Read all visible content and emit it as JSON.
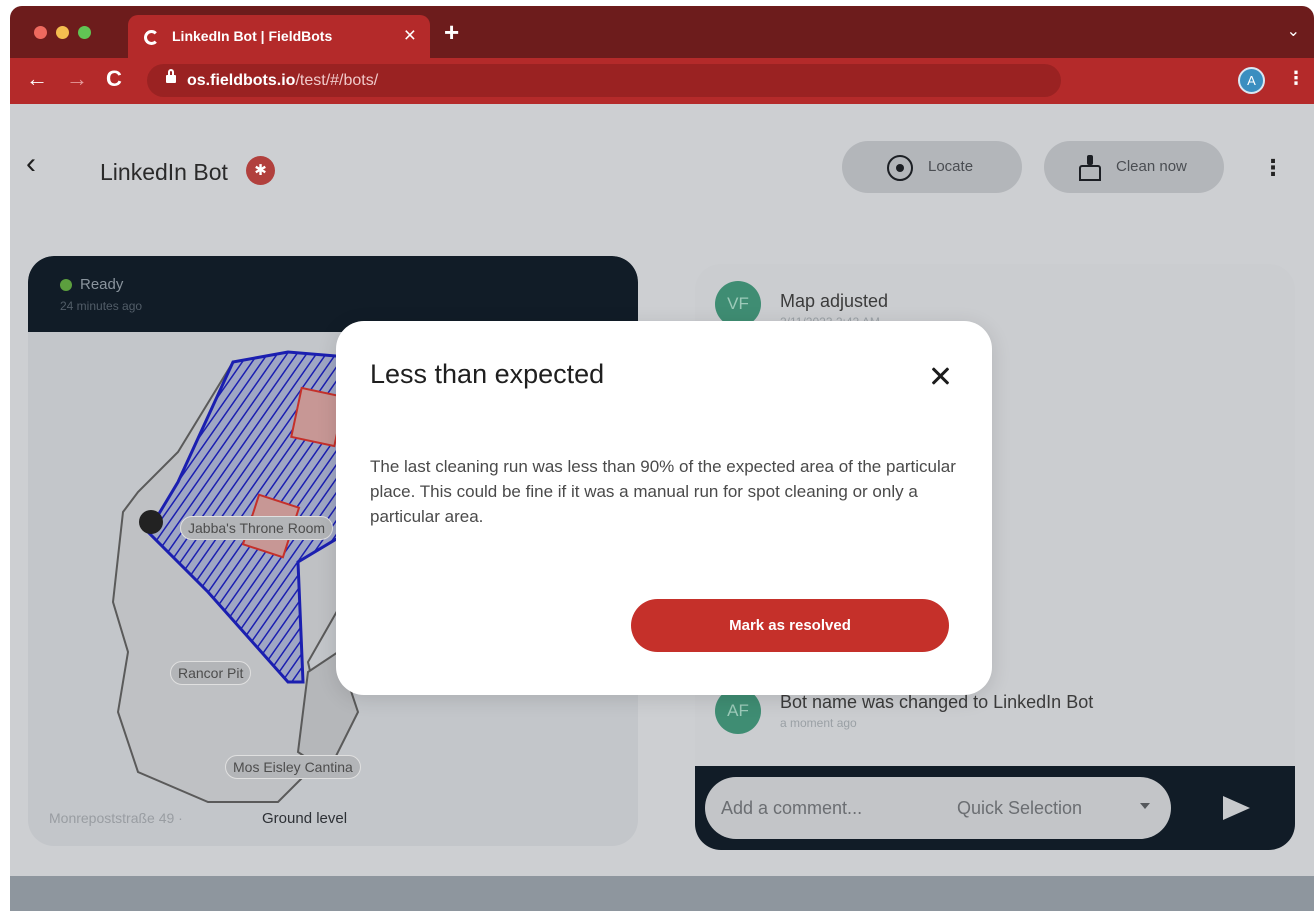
{
  "browser": {
    "tab_title": "LinkedIn Bot | FieldBots",
    "tab_close": "×",
    "new_tab": "+",
    "tabs_menu": "⌄",
    "url_host": "os.fieldbots.io",
    "url_path": "/test/#/bots/",
    "profile_initial": "A",
    "traffic_lights": [
      "#ee6a5f",
      "#f5bd4f",
      "#61c454"
    ],
    "chrome_color": "#b42a2a"
  },
  "header": {
    "back_icon": "‹",
    "title": "LinkedIn Bot",
    "locate_label": "Locate",
    "clean_label": "Clean now",
    "more_icon": "⋮"
  },
  "map": {
    "status": "Ready",
    "status_time": "24 minutes ago",
    "rooms": [
      "Jabba's Throne Room",
      "Rancor Pit",
      "Mos Eisley Cantina"
    ],
    "address": "Monrepoststraße 49 ·",
    "level": "Ground level"
  },
  "activity": {
    "items": [
      {
        "initials": "VF",
        "title": "Map adjusted",
        "time": "2/11/2023 2:42 AM"
      },
      {
        "initials": "AF",
        "title": "Bot name was changed to LinkedIn Bot",
        "time": "a moment ago"
      }
    ],
    "comment_placeholder": "Add a comment...",
    "quick_selection": "Quick Selection"
  },
  "modal": {
    "title": "Less than expected",
    "body": "The last cleaning run was less than 90% of the expected area of the particular place. This could be fine if it was a manual run for spot cleaning or only a particular area.",
    "resolve_label": "Mark as resolved",
    "accent": "#c5302a"
  }
}
